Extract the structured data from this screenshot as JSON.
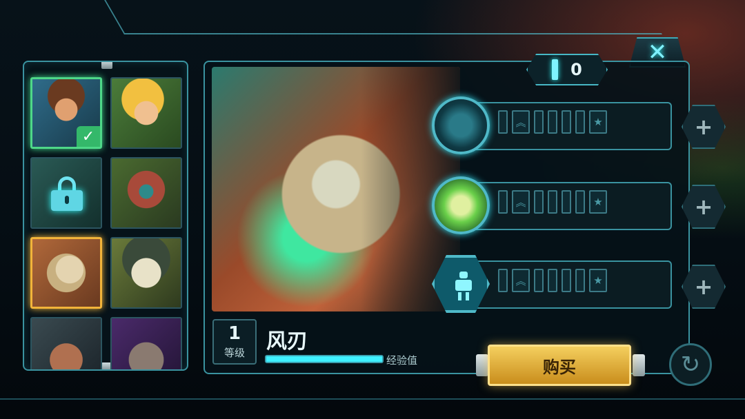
{
  "close": {
    "label": "✕"
  },
  "points": {
    "value": "0"
  },
  "heroes": [
    {
      "name": "hero-1",
      "state": "selected"
    },
    {
      "name": "hero-2",
      "state": "unlocked"
    },
    {
      "name": "hero-3",
      "state": "locked"
    },
    {
      "name": "hero-4",
      "state": "unlocked"
    },
    {
      "name": "hero-5",
      "state": "current"
    },
    {
      "name": "hero-6",
      "state": "unlocked"
    },
    {
      "name": "hero-7",
      "state": "unlocked"
    },
    {
      "name": "hero-8",
      "state": "unlocked"
    }
  ],
  "hero_detail": {
    "level_value": "1",
    "level_label": "等级",
    "name": "风刃",
    "xp_label": "经验值",
    "xp_progress": 1.0
  },
  "skills": [
    {
      "icon": "orb-skill-icon",
      "pips_filled": 0
    },
    {
      "icon": "shield-skill-icon",
      "pips_filled": 0
    },
    {
      "icon": "robot-skill-icon",
      "pips_filled": 0
    }
  ],
  "skill_plus_label": "+",
  "buy_label": "购买",
  "reset_icon": "refresh-icon",
  "colors": {
    "accent": "#3ff0ff",
    "frame": "#3a93a0",
    "buy": "#f4cf5e",
    "selected": "#4ed888",
    "current": "#f2b43a"
  }
}
